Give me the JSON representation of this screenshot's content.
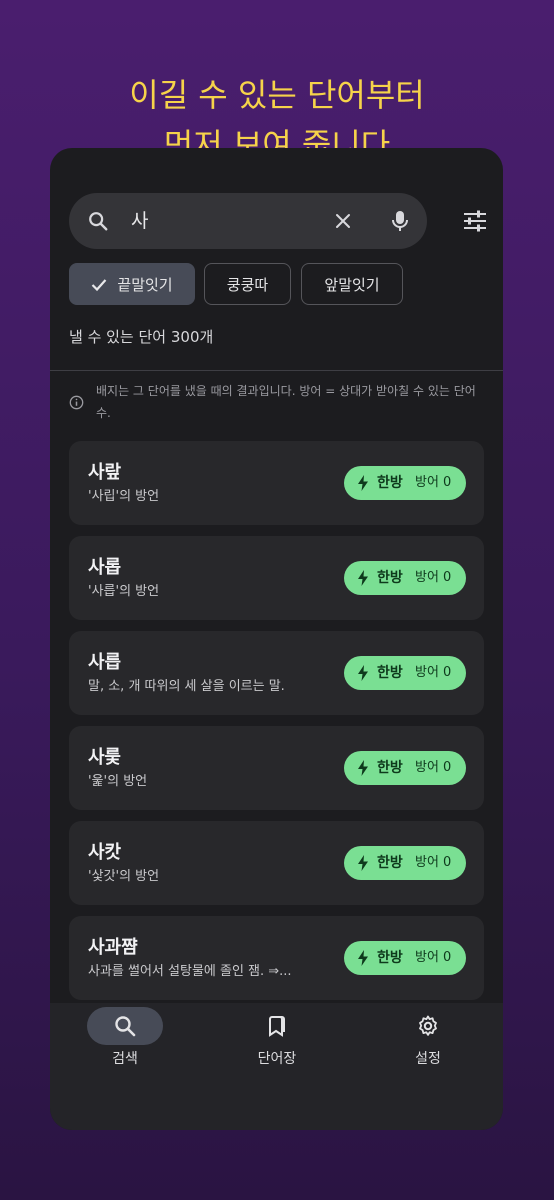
{
  "headline": {
    "line1": "이길 수 있는 단어부터",
    "line2": "먼저 보여 줍니다"
  },
  "search": {
    "query": "사"
  },
  "filters": [
    {
      "label": "끝말잇기",
      "selected": true
    },
    {
      "label": "쿵쿵따",
      "selected": false
    },
    {
      "label": "앞말잇기",
      "selected": false
    }
  ],
  "result_count": "낼 수 있는 단어 300개",
  "info_text": "배지는 그 단어를 냈을 때의 결과입니다. 방어 = 상대가 받아칠 수 있는 단어 수.",
  "results": [
    {
      "word": "사랖",
      "definition": "'사립'의 방언",
      "badge": "한방",
      "defense": "방어 0"
    },
    {
      "word": "사롭",
      "definition": "'사릅'의 방언",
      "badge": "한방",
      "defense": "방어 0"
    },
    {
      "word": "사릅",
      "definition": "말, 소, 개 따위의 세 살을 이르는 말.",
      "badge": "한방",
      "defense": "방어 0"
    },
    {
      "word": "사릋",
      "definition": "'욽'의 방언",
      "badge": "한방",
      "defense": "방어 0"
    },
    {
      "word": "사캇",
      "definition": "'샃갓'의 방언",
      "badge": "한방",
      "defense": "방어 0"
    },
    {
      "word": "사과쨤",
      "definition": "사과를 썰어서 설탕물에 졸인 잼. ⇒...",
      "badge": "한방",
      "defense": "방어 0"
    }
  ],
  "nav": [
    {
      "label": "검색",
      "icon": "search-icon",
      "active": true
    },
    {
      "label": "단어장",
      "icon": "bookmarks-icon",
      "active": false
    },
    {
      "label": "설정",
      "icon": "gear-icon",
      "active": false
    }
  ],
  "colors": {
    "accent": "#f6d34a",
    "badge": "#7adf93",
    "surface": "#1c1c1f"
  }
}
